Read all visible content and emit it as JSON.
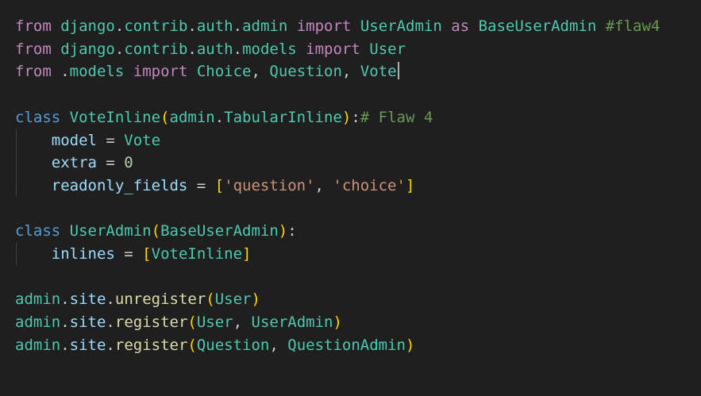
{
  "editor": {
    "lines": [
      [
        [
          "kw-ctrl",
          "from"
        ],
        [
          "plain",
          " "
        ],
        [
          "cls",
          "django"
        ],
        [
          "plain",
          "."
        ],
        [
          "cls",
          "contrib"
        ],
        [
          "plain",
          "."
        ],
        [
          "cls",
          "auth"
        ],
        [
          "plain",
          "."
        ],
        [
          "cls",
          "admin"
        ],
        [
          "plain",
          " "
        ],
        [
          "kw-ctrl",
          "import"
        ],
        [
          "plain",
          " "
        ],
        [
          "cls",
          "UserAdmin"
        ],
        [
          "plain",
          " "
        ],
        [
          "kw-ctrl",
          "as"
        ],
        [
          "plain",
          " "
        ],
        [
          "cls",
          "BaseUserAdmin"
        ],
        [
          "plain",
          " "
        ],
        [
          "cmt",
          "#flaw4"
        ]
      ],
      [
        [
          "kw-ctrl",
          "from"
        ],
        [
          "plain",
          " "
        ],
        [
          "cls",
          "django"
        ],
        [
          "plain",
          "."
        ],
        [
          "cls",
          "contrib"
        ],
        [
          "plain",
          "."
        ],
        [
          "cls",
          "auth"
        ],
        [
          "plain",
          "."
        ],
        [
          "cls",
          "models"
        ],
        [
          "plain",
          " "
        ],
        [
          "kw-ctrl",
          "import"
        ],
        [
          "plain",
          " "
        ],
        [
          "cls",
          "User"
        ]
      ],
      [
        [
          "kw-ctrl",
          "from"
        ],
        [
          "plain",
          " ."
        ],
        [
          "cls",
          "models"
        ],
        [
          "plain",
          " "
        ],
        [
          "kw-ctrl",
          "import"
        ],
        [
          "plain",
          " "
        ],
        [
          "cls",
          "Choice"
        ],
        [
          "plain",
          ", "
        ],
        [
          "cls",
          "Question"
        ],
        [
          "plain",
          ", "
        ],
        [
          "cls",
          "Vote"
        ]
      ],
      [],
      [
        [
          "kw",
          "class"
        ],
        [
          "plain",
          " "
        ],
        [
          "cls",
          "VoteInline"
        ],
        [
          "p1",
          "("
        ],
        [
          "cls",
          "admin"
        ],
        [
          "plain",
          "."
        ],
        [
          "cls",
          "TabularInline"
        ],
        [
          "p1",
          ")"
        ],
        [
          "plain",
          ":"
        ],
        [
          "cmt",
          "# Flaw 4"
        ]
      ],
      [
        [
          "plain",
          "    "
        ],
        [
          "var",
          "model"
        ],
        [
          "plain",
          " = "
        ],
        [
          "cls",
          "Vote"
        ]
      ],
      [
        [
          "plain",
          "    "
        ],
        [
          "var",
          "extra"
        ],
        [
          "plain",
          " = "
        ],
        [
          "num",
          "0"
        ]
      ],
      [
        [
          "plain",
          "    "
        ],
        [
          "var",
          "readonly_fields"
        ],
        [
          "plain",
          " = "
        ],
        [
          "p1",
          "["
        ],
        [
          "str",
          "'question'"
        ],
        [
          "plain",
          ", "
        ],
        [
          "str",
          "'choice'"
        ],
        [
          "p1",
          "]"
        ]
      ],
      [],
      [
        [
          "kw",
          "class"
        ],
        [
          "plain",
          " "
        ],
        [
          "cls",
          "UserAdmin"
        ],
        [
          "p1",
          "("
        ],
        [
          "cls",
          "BaseUserAdmin"
        ],
        [
          "p1",
          ")"
        ],
        [
          "plain",
          ":"
        ]
      ],
      [
        [
          "plain",
          "    "
        ],
        [
          "var",
          "inlines"
        ],
        [
          "plain",
          " = "
        ],
        [
          "p1",
          "["
        ],
        [
          "cls",
          "VoteInline"
        ],
        [
          "p1",
          "]"
        ]
      ],
      [],
      [
        [
          "cls",
          "admin"
        ],
        [
          "plain",
          "."
        ],
        [
          "var",
          "site"
        ],
        [
          "plain",
          "."
        ],
        [
          "fn",
          "unregister"
        ],
        [
          "p1",
          "("
        ],
        [
          "cls",
          "User"
        ],
        [
          "p1",
          ")"
        ]
      ],
      [
        [
          "cls",
          "admin"
        ],
        [
          "plain",
          "."
        ],
        [
          "var",
          "site"
        ],
        [
          "plain",
          "."
        ],
        [
          "fn",
          "register"
        ],
        [
          "p1",
          "("
        ],
        [
          "cls",
          "User"
        ],
        [
          "plain",
          ", "
        ],
        [
          "cls",
          "UserAdmin"
        ],
        [
          "p1",
          ")"
        ]
      ],
      [
        [
          "cls",
          "admin"
        ],
        [
          "plain",
          "."
        ],
        [
          "var",
          "site"
        ],
        [
          "plain",
          "."
        ],
        [
          "fn",
          "register"
        ],
        [
          "p1",
          "("
        ],
        [
          "cls",
          "Question"
        ],
        [
          "plain",
          ", "
        ],
        [
          "cls",
          "QuestionAdmin"
        ],
        [
          "p1",
          ")"
        ]
      ]
    ],
    "cursor_line": 2
  }
}
